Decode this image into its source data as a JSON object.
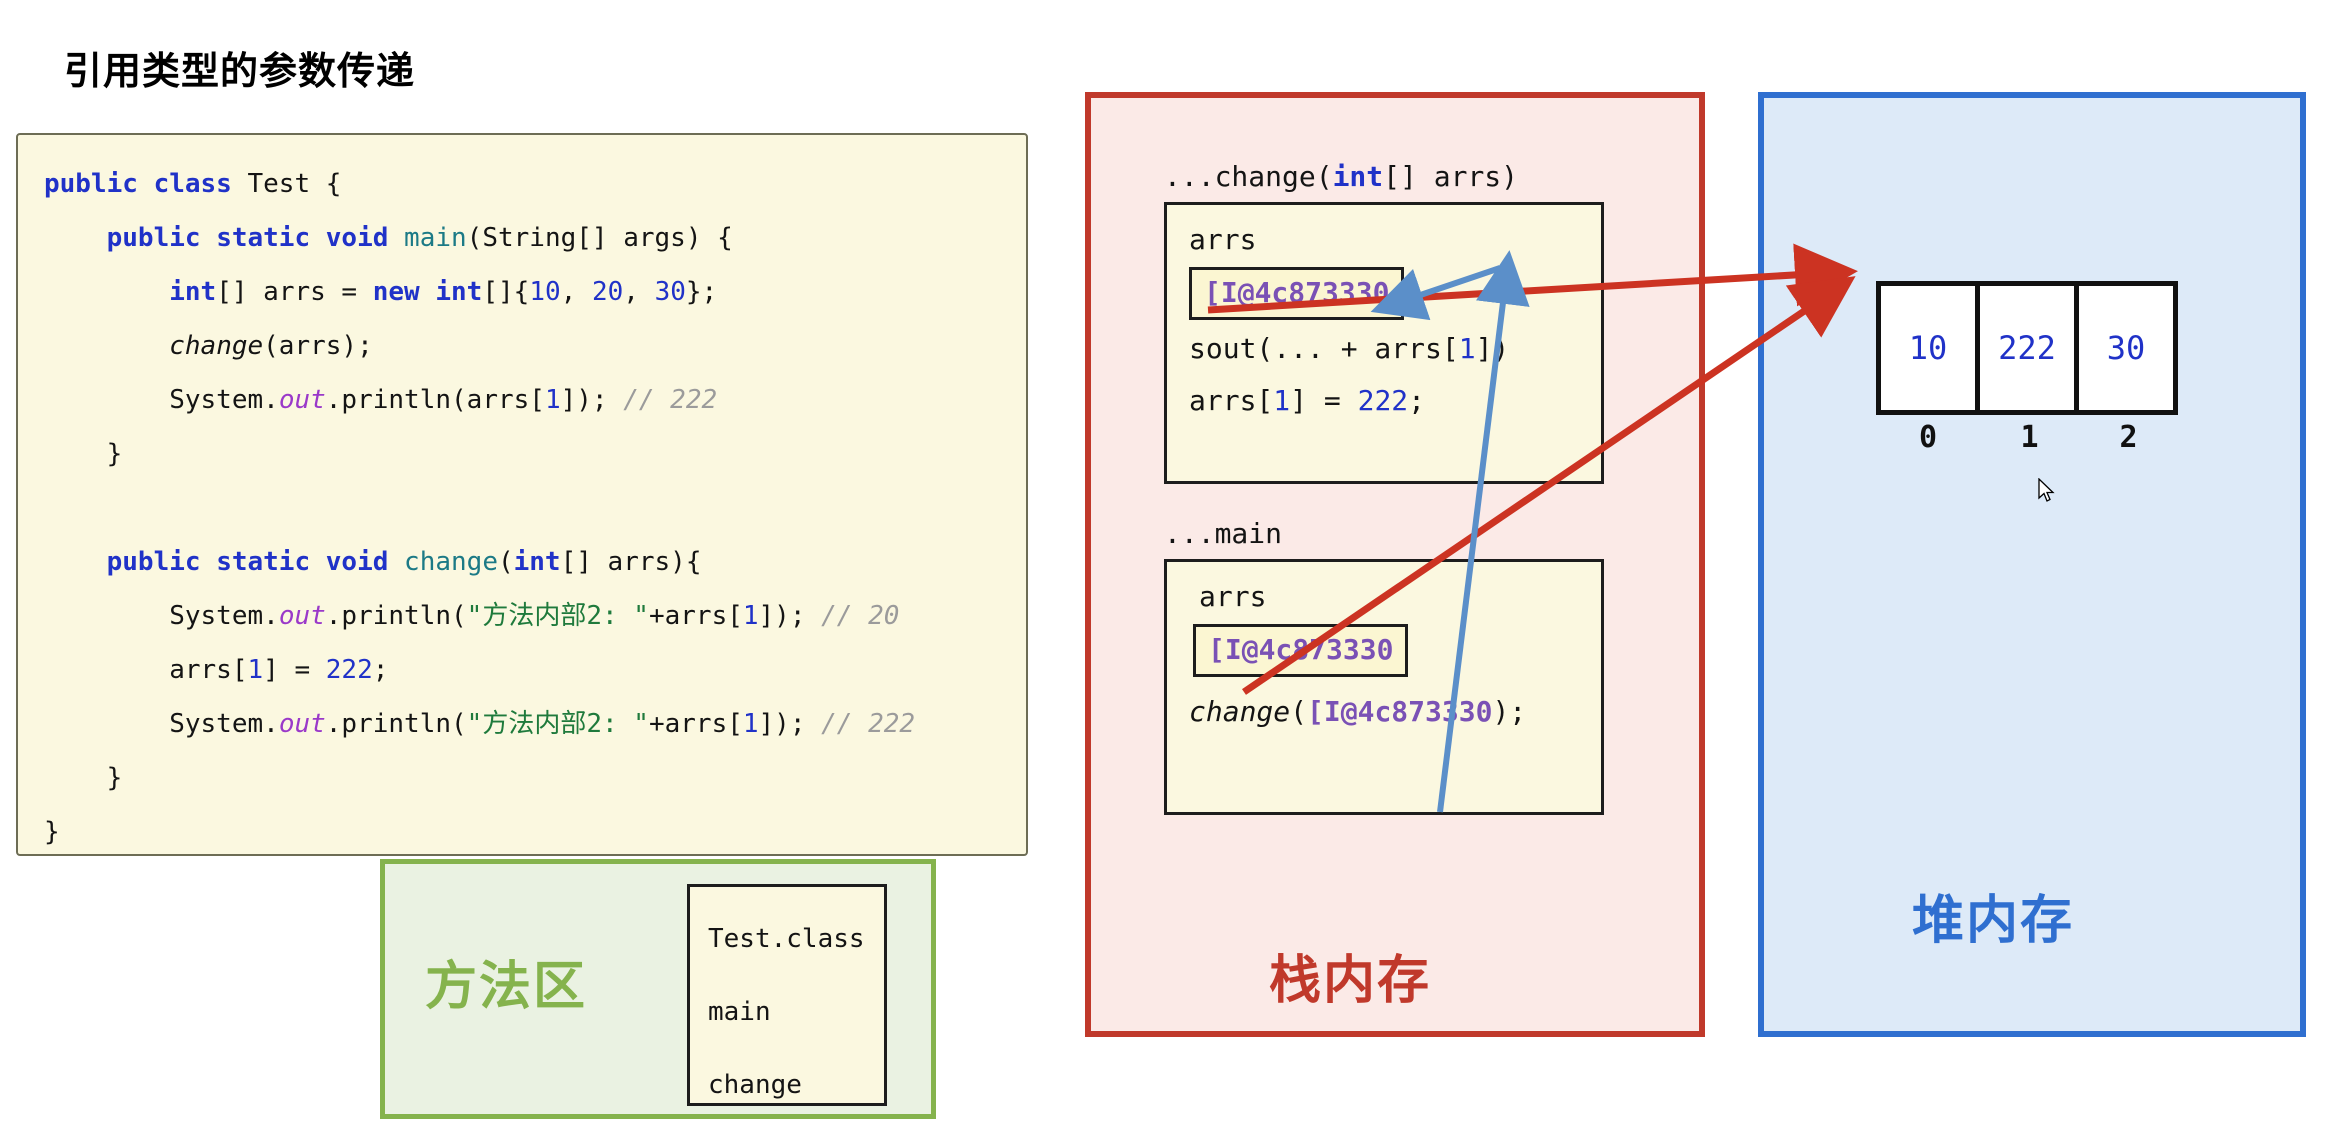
{
  "page": {
    "title": "引用类型的参数传递"
  },
  "code_panel": {
    "lines": [
      [
        {
          "t": "public class ",
          "c": "kw"
        },
        {
          "t": "Test {",
          "c": "plain"
        }
      ],
      [
        {
          "t": "    ",
          "c": "plain"
        },
        {
          "t": "public static void ",
          "c": "kw"
        },
        {
          "t": "main",
          "c": "mname"
        },
        {
          "t": "(String[] args) {",
          "c": "plain"
        }
      ],
      [
        {
          "t": "        ",
          "c": "plain"
        },
        {
          "t": "int",
          "c": "kw"
        },
        {
          "t": "[] arrs = ",
          "c": "plain"
        },
        {
          "t": "new ",
          "c": "kw"
        },
        {
          "t": "int",
          "c": "kw"
        },
        {
          "t": "[]{",
          "c": "plain"
        },
        {
          "t": "10",
          "c": "num"
        },
        {
          "t": ", ",
          "c": "plain"
        },
        {
          "t": "20",
          "c": "num"
        },
        {
          "t": ", ",
          "c": "plain"
        },
        {
          "t": "30",
          "c": "num"
        },
        {
          "t": "};",
          "c": "plain"
        }
      ],
      [
        {
          "t": "        ",
          "c": "plain"
        },
        {
          "t": "change",
          "c": "italic-black"
        },
        {
          "t": "(arrs);",
          "c": "plain"
        }
      ],
      [
        {
          "t": "        System.",
          "c": "plain"
        },
        {
          "t": "out",
          "c": "field"
        },
        {
          "t": ".println(arrs[",
          "c": "plain"
        },
        {
          "t": "1",
          "c": "num"
        },
        {
          "t": "]); ",
          "c": "plain"
        },
        {
          "t": "// 222",
          "c": "cmt"
        }
      ],
      [
        {
          "t": "    }",
          "c": "plain"
        }
      ],
      [
        {
          "t": " ",
          "c": "plain"
        }
      ],
      [
        {
          "t": "    ",
          "c": "plain"
        },
        {
          "t": "public static void ",
          "c": "kw"
        },
        {
          "t": "change",
          "c": "mname"
        },
        {
          "t": "(",
          "c": "plain"
        },
        {
          "t": "int",
          "c": "kw"
        },
        {
          "t": "[] arrs){",
          "c": "plain"
        }
      ],
      [
        {
          "t": "        System.",
          "c": "plain"
        },
        {
          "t": "out",
          "c": "field"
        },
        {
          "t": ".println(",
          "c": "plain"
        },
        {
          "t": "\"方法内部2: \"",
          "c": "str"
        },
        {
          "t": "+arrs[",
          "c": "plain"
        },
        {
          "t": "1",
          "c": "num"
        },
        {
          "t": "]); ",
          "c": "plain"
        },
        {
          "t": "// 20",
          "c": "cmt"
        }
      ],
      [
        {
          "t": "        arrs[",
          "c": "plain"
        },
        {
          "t": "1",
          "c": "num"
        },
        {
          "t": "] = ",
          "c": "plain"
        },
        {
          "t": "222",
          "c": "num"
        },
        {
          "t": ";",
          "c": "plain"
        }
      ],
      [
        {
          "t": "        System.",
          "c": "plain"
        },
        {
          "t": "out",
          "c": "field"
        },
        {
          "t": ".println(",
          "c": "plain"
        },
        {
          "t": "\"方法内部2: \"",
          "c": "str"
        },
        {
          "t": "+arrs[",
          "c": "plain"
        },
        {
          "t": "1",
          "c": "num"
        },
        {
          "t": "]); ",
          "c": "plain"
        },
        {
          "t": "// 222",
          "c": "cmt"
        }
      ],
      [
        {
          "t": "    }",
          "c": "plain"
        }
      ],
      [
        {
          "t": "}",
          "c": "plain"
        }
      ]
    ]
  },
  "method_area": {
    "label": "方法区",
    "class_box_lines": [
      "Test.class",
      "main",
      "change"
    ]
  },
  "stack_memory": {
    "label": "栈内存",
    "frames": [
      {
        "title": "...change(int[] arrs)",
        "title_parts": [
          {
            "t": "...change(",
            "c": "plain"
          },
          {
            "t": "int",
            "c": "kw"
          },
          {
            "t": "[] arrs)",
            "c": "plain"
          }
        ],
        "var_name": "arrs",
        "ref_value": "[I@4c873330",
        "body_lines": [
          [
            {
              "t": "sout(... + arrs[",
              "c": "plain"
            },
            {
              "t": "1",
              "c": "num"
            },
            {
              "t": "])",
              "c": "plain"
            }
          ],
          [
            {
              "t": "arrs[",
              "c": "plain"
            },
            {
              "t": "1",
              "c": "num"
            },
            {
              "t": "] = ",
              "c": "plain"
            },
            {
              "t": "222",
              "c": "num"
            },
            {
              "t": ";",
              "c": "plain"
            }
          ]
        ]
      },
      {
        "title": "...main",
        "title_parts": [
          {
            "t": "...main",
            "c": "plain"
          }
        ],
        "var_name": "arrs",
        "ref_value": "[I@4c873330",
        "body_lines": [
          [
            {
              "t": "change",
              "c": "italic-black"
            },
            {
              "t": "(",
              "c": "plain"
            },
            {
              "t": "[I@4c873330",
              "c": "ref"
            },
            {
              "t": ");",
              "c": "plain"
            }
          ]
        ]
      }
    ]
  },
  "heap_memory": {
    "label": "堆内存",
    "array_values": [
      "10",
      "222",
      "30"
    ],
    "array_indices": [
      "0",
      "1",
      "2"
    ]
  },
  "colors": {
    "stack_accent": "#c0392b",
    "heap_accent": "#2f6fd0",
    "method_accent": "#85b34d",
    "code_bg": "#fbf8e0",
    "keyword": "#2032c8",
    "method_name": "#1c7a86",
    "field": "#9a39c9",
    "string": "#1f7a3c",
    "comment": "#9b9b9b",
    "reference": "#7a51b5"
  }
}
